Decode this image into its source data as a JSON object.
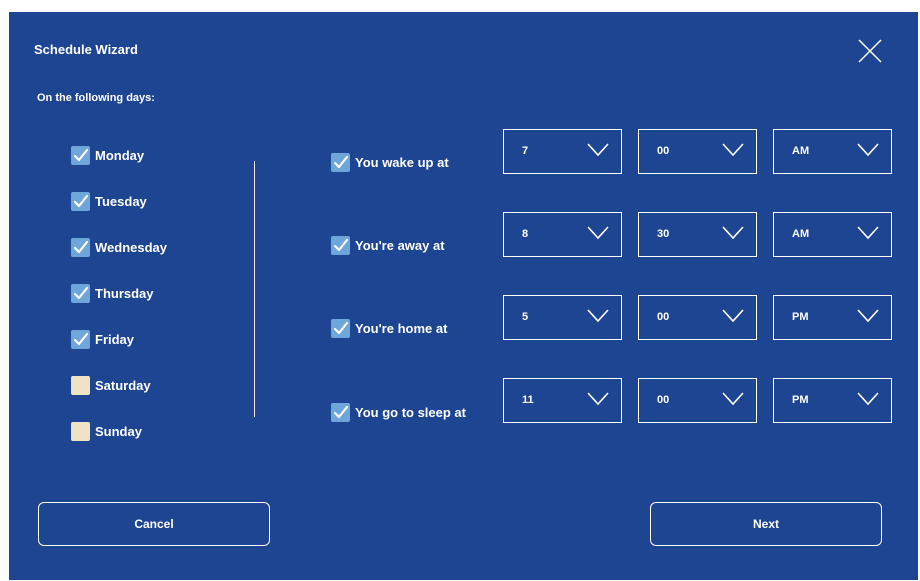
{
  "dialog": {
    "title": "Schedule Wizard",
    "days_label": "On the following days:",
    "colors": {
      "background": "#1e4591",
      "checked": "#6fa6d9",
      "unchecked": "#efe3c4"
    }
  },
  "days": [
    {
      "label": "Monday",
      "checked": true
    },
    {
      "label": "Tuesday",
      "checked": true
    },
    {
      "label": "Wednesday",
      "checked": true
    },
    {
      "label": "Thursday",
      "checked": true
    },
    {
      "label": "Friday",
      "checked": true
    },
    {
      "label": "Saturday",
      "checked": false
    },
    {
      "label": "Sunday",
      "checked": false
    }
  ],
  "events": [
    {
      "label": "You wake up at",
      "checked": true,
      "hour": "7",
      "minute": "00",
      "period": "AM"
    },
    {
      "label": "You're away at",
      "checked": true,
      "hour": "8",
      "minute": "30",
      "period": "AM"
    },
    {
      "label": "You're home at",
      "checked": true,
      "hour": "5",
      "minute": "00",
      "period": "PM"
    },
    {
      "label": "You go to sleep at",
      "checked": true,
      "hour": "11",
      "minute": "00",
      "period": "PM"
    }
  ],
  "buttons": {
    "cancel": "Cancel",
    "next": "Next"
  }
}
